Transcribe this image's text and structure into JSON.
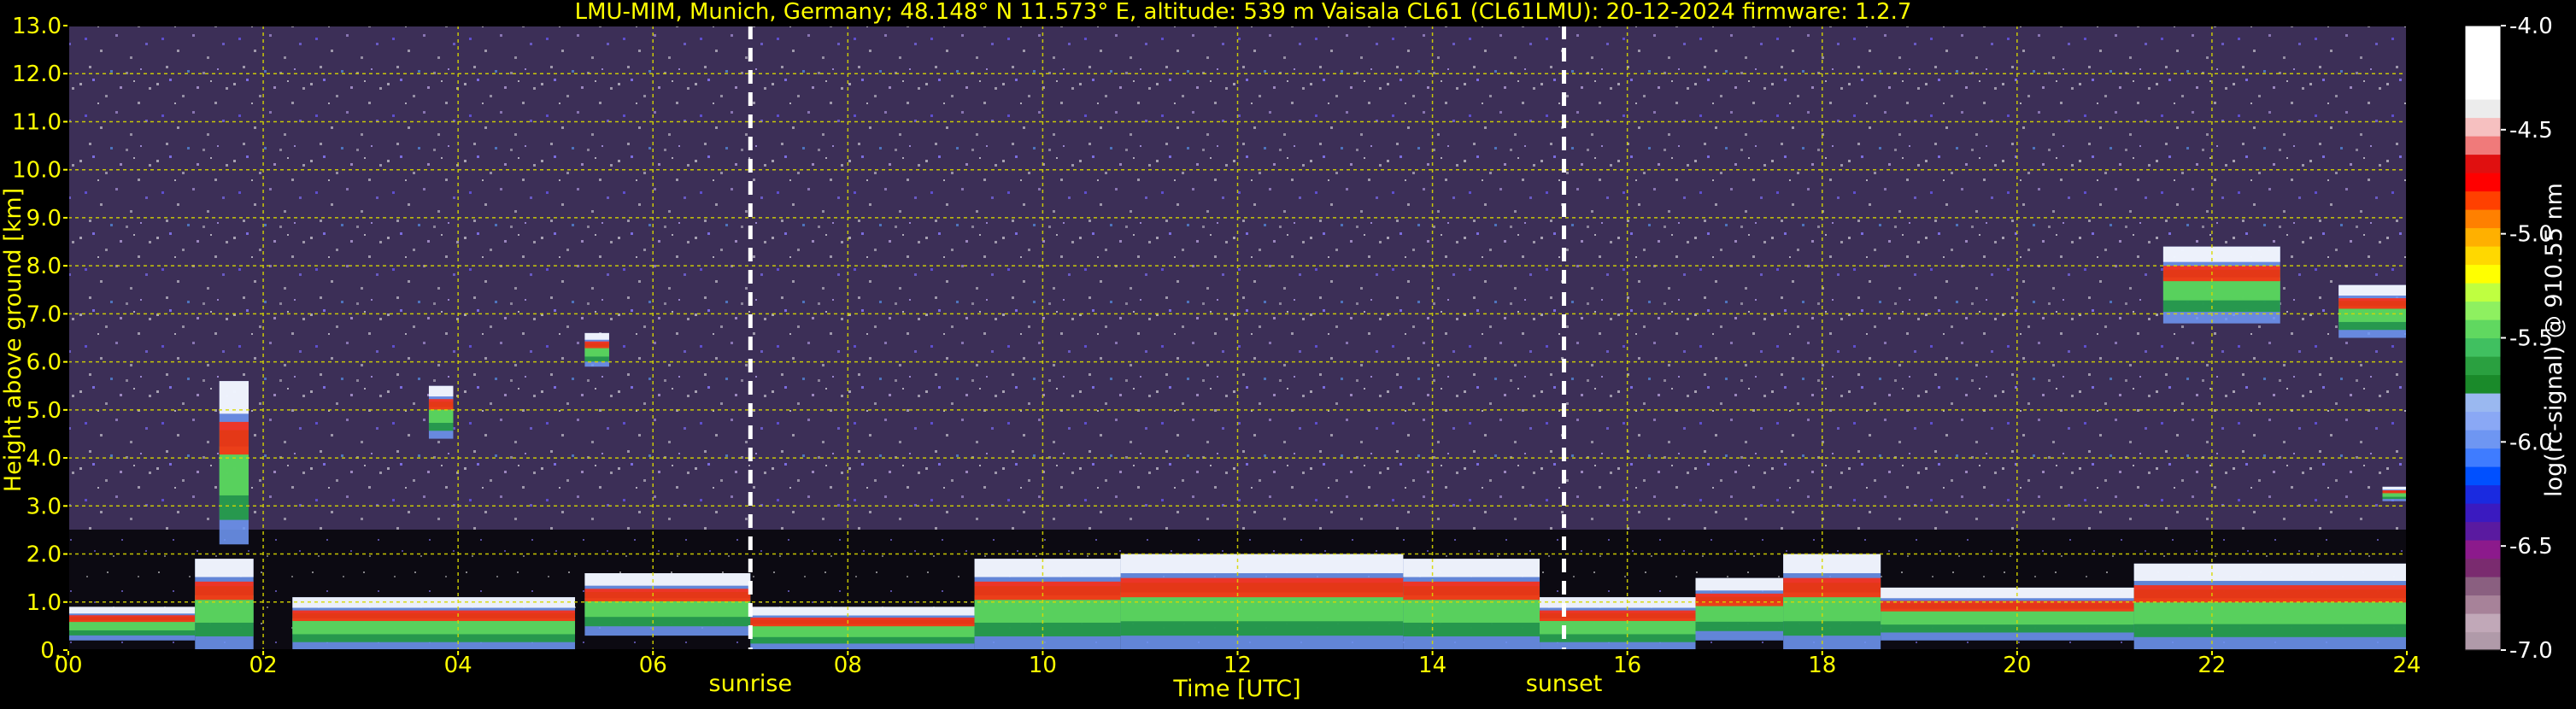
{
  "chart_data": {
    "type": "heatmap",
    "title": "LMU-MIM, Munich, Germany; 48.148° N 11.573° E, altitude: 539 m    Vaisala CL61 (CL61LMU): 20-12-2024    firmware: 1.2.7",
    "xlabel": "Time [UTC]",
    "ylabel": "Height above ground [km]",
    "x_ticks": [
      "00",
      "02",
      "04",
      "06",
      "08",
      "10",
      "12",
      "14",
      "16",
      "18",
      "20",
      "22",
      "24"
    ],
    "y_ticks": [
      "0.",
      "1.0",
      "2.0",
      "3.0",
      "4.0",
      "5.0",
      "6.0",
      "7.0",
      "8.0",
      "9.0",
      "10.0",
      "11.0",
      "12.0",
      "13.0"
    ],
    "xlim": [
      0,
      24
    ],
    "ylim": [
      0,
      13
    ],
    "grid": true,
    "colorbar": {
      "label": "log(rc-signal) @ 910.55 nm",
      "ticks": [
        "-4.0",
        "-4.5",
        "-5.0",
        "-5.5",
        "-6.0",
        "-6.5",
        "-7.0"
      ],
      "range": [
        -7.0,
        -4.0
      ],
      "colors": [
        "#b09aa9",
        "#c1a8b8",
        "#a78299",
        "#8a5f80",
        "#7a2b6f",
        "#8c1a8c",
        "#5a1aa0",
        "#3a1ac0",
        "#1a2ae0",
        "#0050ff",
        "#3f7cff",
        "#6e96f2",
        "#8aa8f5",
        "#9ab8f0",
        "#1a8a2a",
        "#2aa040",
        "#40c060",
        "#60d860",
        "#8ef060",
        "#bfff40",
        "#ffff00",
        "#ffd800",
        "#ffb000",
        "#ff8000",
        "#ff4000",
        "#ff0000",
        "#e01010",
        "#f07a7a",
        "#f6c0c0",
        "#ececec",
        "#ffffff",
        "#ffffff",
        "#ffffff",
        "#ffffff"
      ]
    },
    "markers": [
      {
        "label": "sunrise",
        "x": 7.0
      },
      {
        "label": "sunset",
        "x": 15.35
      }
    ],
    "cloud_layers": [
      {
        "t0": 0.0,
        "t1": 1.3,
        "base": 0.2,
        "top": 0.9
      },
      {
        "t0": 1.3,
        "t1": 1.9,
        "base": 0.0,
        "top": 1.9
      },
      {
        "t0": 1.55,
        "t1": 1.85,
        "base": 2.2,
        "top": 5.6
      },
      {
        "t0": 2.3,
        "t1": 5.2,
        "base": 0.0,
        "top": 1.1
      },
      {
        "t0": 3.7,
        "t1": 3.95,
        "base": 4.4,
        "top": 5.5
      },
      {
        "t0": 5.3,
        "t1": 5.55,
        "base": 5.9,
        "top": 6.6
      },
      {
        "t0": 5.3,
        "t1": 7.0,
        "base": 0.3,
        "top": 1.6
      },
      {
        "t0": 7.0,
        "t1": 9.3,
        "base": 0.0,
        "top": 0.9
      },
      {
        "t0": 9.3,
        "t1": 10.8,
        "base": 0.0,
        "top": 1.9
      },
      {
        "t0": 10.8,
        "t1": 13.7,
        "base": 0.0,
        "top": 2.0
      },
      {
        "t0": 13.7,
        "t1": 15.1,
        "base": 0.0,
        "top": 1.9
      },
      {
        "t0": 15.1,
        "t1": 16.7,
        "base": 0.0,
        "top": 1.1
      },
      {
        "t0": 16.7,
        "t1": 17.6,
        "base": 0.2,
        "top": 1.5
      },
      {
        "t0": 17.6,
        "t1": 18.6,
        "base": 0.0,
        "top": 2.0
      },
      {
        "t0": 18.6,
        "t1": 21.2,
        "base": 0.2,
        "top": 1.3
      },
      {
        "t0": 21.2,
        "t1": 24.0,
        "base": 0.0,
        "top": 1.8
      },
      {
        "t0": 21.5,
        "t1": 22.7,
        "base": 6.8,
        "top": 8.4
      },
      {
        "t0": 23.3,
        "t1": 24.0,
        "base": 6.5,
        "top": 7.6
      },
      {
        "t0": 23.75,
        "t1": 24.0,
        "base": 3.1,
        "top": 3.4
      }
    ]
  }
}
